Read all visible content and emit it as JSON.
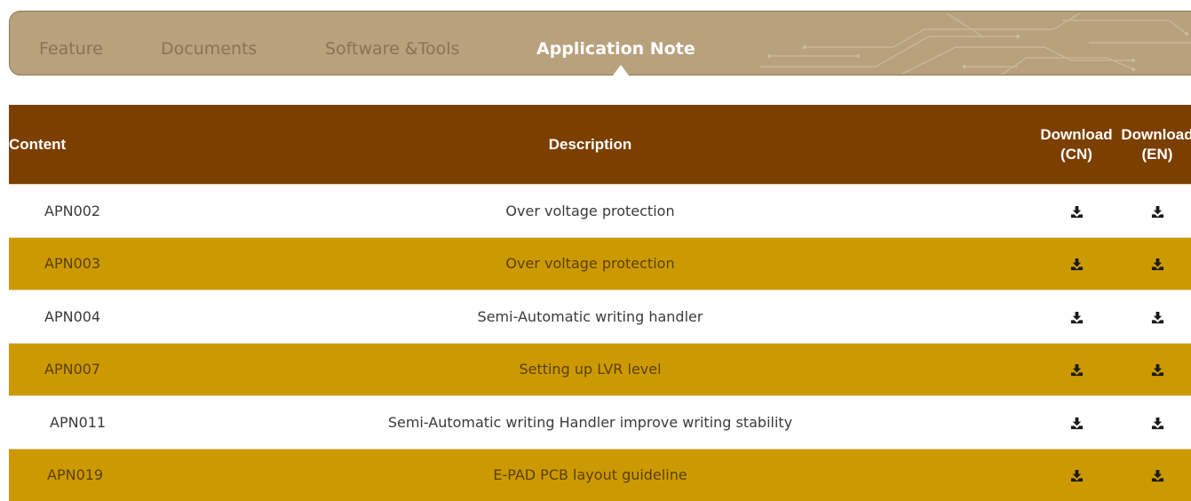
{
  "tabs": [
    {
      "label": "Feature",
      "active": false
    },
    {
      "label": "Documents",
      "active": false
    },
    {
      "label": "Software &Tools",
      "active": false
    },
    {
      "label": "Application Note",
      "active": true
    }
  ],
  "table": {
    "headers": {
      "content": "Content",
      "description": "Description",
      "download_cn_line1": "Download",
      "download_cn_line2": "(CN)",
      "download_en_line1": "Download",
      "download_en_line2": "(EN)"
    },
    "rows": [
      {
        "code": "APN002",
        "description": "Over voltage protection"
      },
      {
        "code": "APN003",
        "description": "Over voltage protection"
      },
      {
        "code": "APN004",
        "description": "Semi-Automatic writing handler"
      },
      {
        "code": "APN007",
        "description": "Setting up LVR level"
      },
      {
        "code": "APN011",
        "description": "Semi-Automatic writing Handler improve writing stability"
      },
      {
        "code": "APN019",
        "description": "E-PAD PCB layout guideline"
      }
    ]
  },
  "icons": {
    "download": "download-icon"
  },
  "colors": {
    "tab_bar": "#b8a17d",
    "tab_inactive_text": "#8b7352",
    "header_bg": "#7b3f00",
    "stripe_row": "#cc9a00",
    "icon_dark": "#1a1a1a"
  }
}
